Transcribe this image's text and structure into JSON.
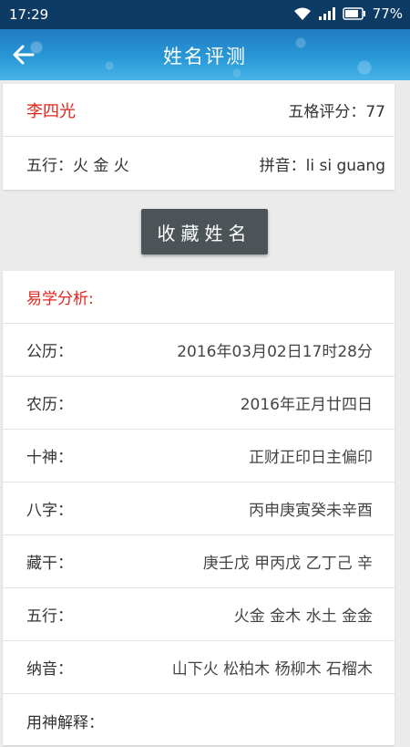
{
  "status_bar": {
    "time": "17:29",
    "battery": "77%"
  },
  "app_bar": {
    "title": "姓名评测"
  },
  "summary": {
    "name": "李四光",
    "score_label": "五格评分：77",
    "wuxing_label": "五行：火 金 火",
    "pinyin_label": "拼音：li si guang"
  },
  "collect_button": "收藏姓名",
  "analysis": {
    "title": "易学分析:",
    "rows": [
      {
        "label": "公历：",
        "value": "2016年03月02日17时28分"
      },
      {
        "label": "农历：",
        "value": "2016年正月廿四日"
      },
      {
        "label": "十神：",
        "value": "正财正印日主偏印"
      },
      {
        "label": "八字：",
        "value": "丙申庚寅癸未辛酉"
      },
      {
        "label": "藏干：",
        "value": "庚壬戊 甲丙戊 乙丁己 辛"
      },
      {
        "label": "五行：",
        "value": "火金 金木 水土 金金"
      },
      {
        "label": "纳音：",
        "value": "山下火 松柏木 杨柳木 石榴木"
      },
      {
        "label": "用神解释：",
        "value": ""
      }
    ]
  },
  "icons": {
    "back": "arrow-left-icon",
    "wifi": "wifi-icon",
    "signal": "signal-icon",
    "battery": "battery-icon"
  }
}
